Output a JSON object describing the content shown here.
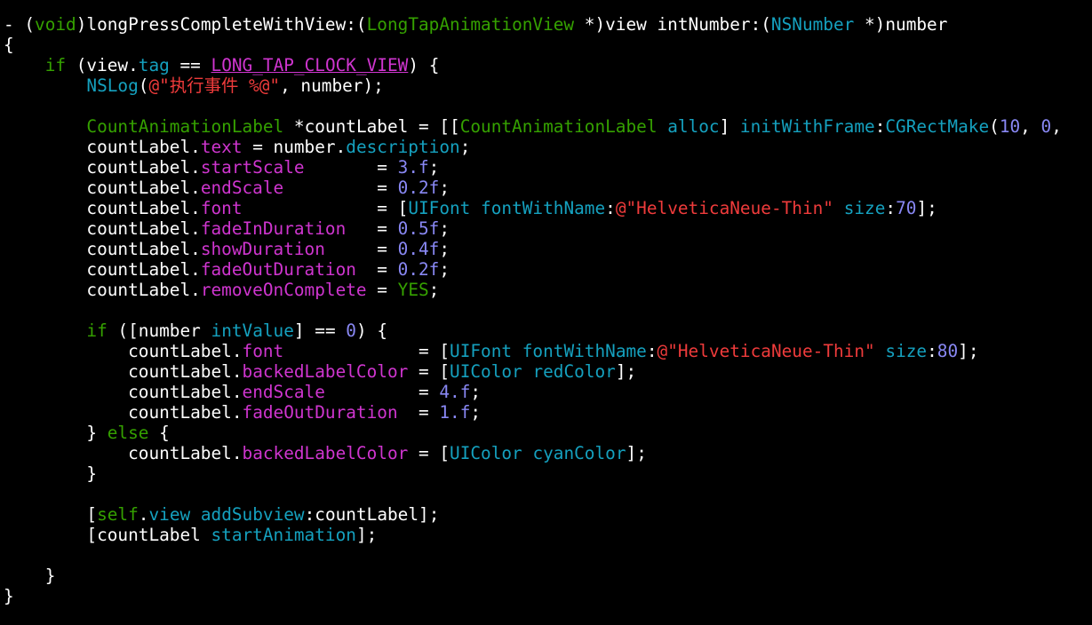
{
  "editor": {
    "language": "Objective-C",
    "theme": "dark",
    "colors": {
      "background": "#000000",
      "plain": "#ffffff",
      "keyword": "#35a100",
      "type": "#15a1bf",
      "property": "#cf35cf",
      "method": "#15a1bf",
      "string": "#ef3b3b",
      "number": "#8988f4",
      "macro": "#cf35cf"
    },
    "lines": [
      [
        [
          "plain",
          "- ("
        ],
        [
          "keyword",
          "void"
        ],
        [
          "plain",
          ")longPressCompleteWithView:("
        ],
        [
          "classname",
          "LongTapAnimationView"
        ],
        [
          "plain",
          " *)view intNumber:("
        ],
        [
          "type",
          "NSNumber"
        ],
        [
          "plain",
          " *)number"
        ]
      ],
      [
        [
          "plain",
          "{"
        ]
      ],
      [
        [
          "plain",
          "    "
        ],
        [
          "keyword",
          "if"
        ],
        [
          "plain",
          " (view."
        ],
        [
          "type",
          "tag"
        ],
        [
          "plain",
          " == "
        ],
        [
          "macro",
          "LONG_TAP_CLOCK_VIEW"
        ],
        [
          "plain",
          ") {"
        ]
      ],
      [
        [
          "plain",
          "        "
        ],
        [
          "type",
          "NSLog"
        ],
        [
          "plain",
          "("
        ],
        [
          "string",
          "@\"执行事件 %@\""
        ],
        [
          "plain",
          ", number);"
        ]
      ],
      [
        [
          "plain",
          ""
        ]
      ],
      [
        [
          "plain",
          "        "
        ],
        [
          "classname",
          "CountAnimationLabel"
        ],
        [
          "plain",
          " *countLabel = [["
        ],
        [
          "classname",
          "CountAnimationLabel"
        ],
        [
          "plain",
          " "
        ],
        [
          "type",
          "alloc"
        ],
        [
          "plain",
          "] "
        ],
        [
          "method",
          "initWithFrame"
        ],
        [
          "plain",
          ":"
        ],
        [
          "type",
          "CGRectMake"
        ],
        [
          "plain",
          "("
        ],
        [
          "number",
          "10"
        ],
        [
          "plain",
          ", "
        ],
        [
          "number",
          "0"
        ],
        [
          "plain",
          ","
        ]
      ],
      [
        [
          "plain",
          "        countLabel."
        ],
        [
          "prop",
          "text"
        ],
        [
          "plain",
          " = number."
        ],
        [
          "type",
          "description"
        ],
        [
          "plain",
          ";"
        ]
      ],
      [
        [
          "plain",
          "        countLabel."
        ],
        [
          "prop",
          "startScale"
        ],
        [
          "plain",
          "       = "
        ],
        [
          "number",
          "3.f"
        ],
        [
          "plain",
          ";"
        ]
      ],
      [
        [
          "plain",
          "        countLabel."
        ],
        [
          "prop",
          "endScale"
        ],
        [
          "plain",
          "         = "
        ],
        [
          "number",
          "0.2f"
        ],
        [
          "plain",
          ";"
        ]
      ],
      [
        [
          "plain",
          "        countLabel."
        ],
        [
          "prop",
          "font"
        ],
        [
          "plain",
          "             = ["
        ],
        [
          "type",
          "UIFont"
        ],
        [
          "plain",
          " "
        ],
        [
          "method",
          "fontWithName"
        ],
        [
          "plain",
          ":"
        ],
        [
          "string",
          "@\"HelveticaNeue-Thin\""
        ],
        [
          "plain",
          " "
        ],
        [
          "method",
          "size"
        ],
        [
          "plain",
          ":"
        ],
        [
          "number",
          "70"
        ],
        [
          "plain",
          "];"
        ]
      ],
      [
        [
          "plain",
          "        countLabel."
        ],
        [
          "prop",
          "fadeInDuration"
        ],
        [
          "plain",
          "   = "
        ],
        [
          "number",
          "0.5f"
        ],
        [
          "plain",
          ";"
        ]
      ],
      [
        [
          "plain",
          "        countLabel."
        ],
        [
          "prop",
          "showDuration"
        ],
        [
          "plain",
          "     = "
        ],
        [
          "number",
          "0.4f"
        ],
        [
          "plain",
          ";"
        ]
      ],
      [
        [
          "plain",
          "        countLabel."
        ],
        [
          "prop",
          "fadeOutDuration"
        ],
        [
          "plain",
          "  = "
        ],
        [
          "number",
          "0.2f"
        ],
        [
          "plain",
          ";"
        ]
      ],
      [
        [
          "plain",
          "        countLabel."
        ],
        [
          "prop",
          "removeOnComplete"
        ],
        [
          "plain",
          " = "
        ],
        [
          "keyword",
          "YES"
        ],
        [
          "plain",
          ";"
        ]
      ],
      [
        [
          "plain",
          ""
        ]
      ],
      [
        [
          "plain",
          "        "
        ],
        [
          "keyword",
          "if"
        ],
        [
          "plain",
          " ([number "
        ],
        [
          "type",
          "intValue"
        ],
        [
          "plain",
          "] == "
        ],
        [
          "number",
          "0"
        ],
        [
          "plain",
          ") {"
        ]
      ],
      [
        [
          "plain",
          "            countLabel."
        ],
        [
          "prop",
          "font"
        ],
        [
          "plain",
          "             = ["
        ],
        [
          "type",
          "UIFont"
        ],
        [
          "plain",
          " "
        ],
        [
          "method",
          "fontWithName"
        ],
        [
          "plain",
          ":"
        ],
        [
          "string",
          "@\"HelveticaNeue-Thin\""
        ],
        [
          "plain",
          " "
        ],
        [
          "method",
          "size"
        ],
        [
          "plain",
          ":"
        ],
        [
          "number",
          "80"
        ],
        [
          "plain",
          "];"
        ]
      ],
      [
        [
          "plain",
          "            countLabel."
        ],
        [
          "prop",
          "backedLabelColor"
        ],
        [
          "plain",
          " = ["
        ],
        [
          "type",
          "UIColor"
        ],
        [
          "plain",
          " "
        ],
        [
          "type",
          "redColor"
        ],
        [
          "plain",
          "];"
        ]
      ],
      [
        [
          "plain",
          "            countLabel."
        ],
        [
          "prop",
          "endScale"
        ],
        [
          "plain",
          "         = "
        ],
        [
          "number",
          "4.f"
        ],
        [
          "plain",
          ";"
        ]
      ],
      [
        [
          "plain",
          "            countLabel."
        ],
        [
          "prop",
          "fadeOutDuration"
        ],
        [
          "plain",
          "  = "
        ],
        [
          "number",
          "1.f"
        ],
        [
          "plain",
          ";"
        ]
      ],
      [
        [
          "plain",
          "        } "
        ],
        [
          "keyword",
          "else"
        ],
        [
          "plain",
          " {"
        ]
      ],
      [
        [
          "plain",
          "            countLabel."
        ],
        [
          "prop",
          "backedLabelColor"
        ],
        [
          "plain",
          " = ["
        ],
        [
          "type",
          "UIColor"
        ],
        [
          "plain",
          " "
        ],
        [
          "type",
          "cyanColor"
        ],
        [
          "plain",
          "];"
        ]
      ],
      [
        [
          "plain",
          "        }"
        ]
      ],
      [
        [
          "plain",
          ""
        ]
      ],
      [
        [
          "plain",
          "        ["
        ],
        [
          "keyword",
          "self"
        ],
        [
          "plain",
          "."
        ],
        [
          "type",
          "view"
        ],
        [
          "plain",
          " "
        ],
        [
          "type",
          "addSubview"
        ],
        [
          "plain",
          ":countLabel];"
        ]
      ],
      [
        [
          "plain",
          "        [countLabel "
        ],
        [
          "type",
          "startAnimation"
        ],
        [
          "plain",
          "];"
        ]
      ],
      [
        [
          "plain",
          ""
        ]
      ],
      [
        [
          "plain",
          "    }"
        ]
      ],
      [
        [
          "plain",
          "}"
        ]
      ]
    ]
  }
}
